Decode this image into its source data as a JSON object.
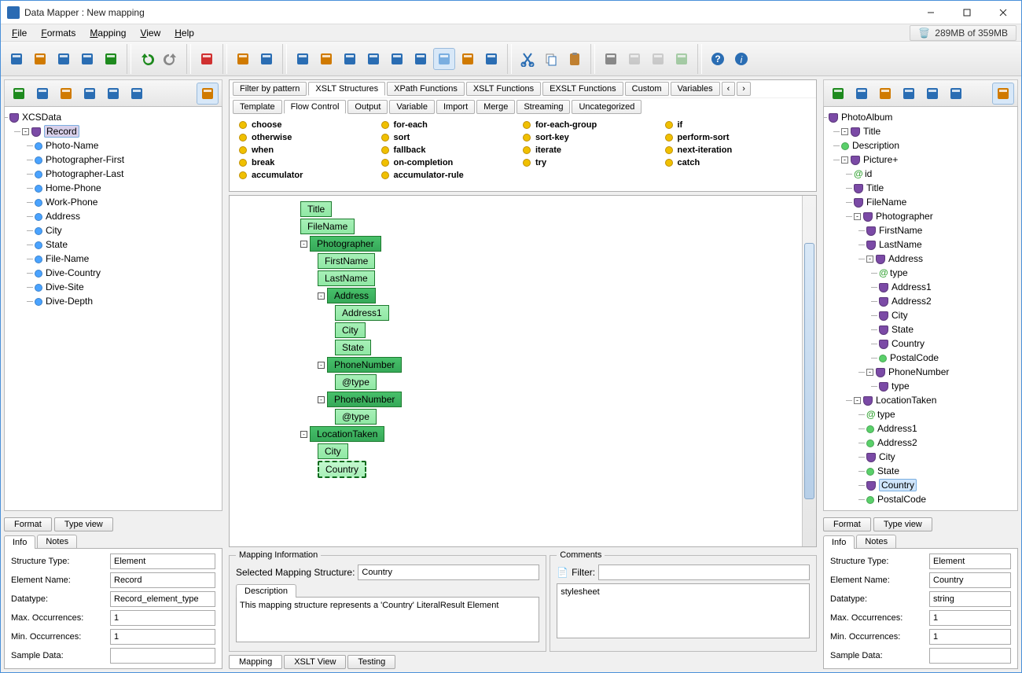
{
  "window": {
    "title": "Data Mapper : New mapping"
  },
  "menu": [
    "File",
    "Formats",
    "Mapping",
    "View",
    "Help"
  ],
  "memory": "289MB of 359MB",
  "left_tree": {
    "root": "XCSData",
    "record": "Record",
    "children": [
      "Photo-Name",
      "Photographer-First",
      "Photographer-Last",
      "Home-Phone",
      "Work-Phone",
      "Address",
      "City",
      "State",
      "File-Name",
      "Dive-Country",
      "Dive-Site",
      "Dive-Depth"
    ]
  },
  "right_tree": {
    "root": "PhotoAlbum",
    "title": "Title",
    "desc": "Description",
    "picture": "Picture+",
    "id": "id",
    "ptitle": "Title",
    "filename": "FileName",
    "photographer": "Photographer",
    "firstname": "FirstName",
    "lastname": "LastName",
    "address": "Address",
    "atype": "type",
    "addr1": "Address1",
    "addr2": "Address2",
    "city": "City",
    "state": "State",
    "country": "Country",
    "postal": "PostalCode",
    "phone": "PhoneNumber",
    "phonetype": "type",
    "loc": "LocationTaken",
    "ltype": "type",
    "laddr1": "Address1",
    "laddr2": "Address2",
    "lcity": "City",
    "lstate": "State",
    "lcountry": "Country",
    "lpostal": "PostalCode"
  },
  "fn_tabs": [
    "Filter by pattern",
    "XSLT Structures",
    "XPath Functions",
    "XSLT Functions",
    "EXSLT Functions",
    "Custom",
    "Variables"
  ],
  "fn_active": 1,
  "fn_cats": [
    "Template",
    "Flow Control",
    "Output",
    "Variable",
    "Import",
    "Merge",
    "Streaming",
    "Uncategorized"
  ],
  "fn_cat_active": 1,
  "fn_items": [
    [
      "choose",
      "for-each",
      "for-each-group",
      "if"
    ],
    [
      "otherwise",
      "sort",
      "sort-key",
      "perform-sort"
    ],
    [
      "when",
      "fallback",
      "iterate",
      "next-iteration"
    ],
    [
      "break",
      "on-completion",
      "try",
      "catch"
    ],
    [
      "accumulator",
      "accumulator-rule",
      "",
      ""
    ]
  ],
  "mapping_nodes": [
    {
      "t": "Title",
      "c": "lt",
      "i": 0
    },
    {
      "t": "FileName",
      "c": "lt",
      "i": 0
    },
    {
      "t": "Photographer",
      "c": "dk",
      "i": 0,
      "h": "-"
    },
    {
      "t": "FirstName",
      "c": "lt",
      "i": 1
    },
    {
      "t": "LastName",
      "c": "lt",
      "i": 1
    },
    {
      "t": "Address",
      "c": "dk",
      "i": 1,
      "h": "-"
    },
    {
      "t": "Address1",
      "c": "lt",
      "i": 2
    },
    {
      "t": "City",
      "c": "lt",
      "i": 2
    },
    {
      "t": "State",
      "c": "lt",
      "i": 2
    },
    {
      "t": "PhoneNumber",
      "c": "dk",
      "i": 1,
      "h": "-"
    },
    {
      "t": "@type",
      "c": "lt",
      "i": 2
    },
    {
      "t": "PhoneNumber",
      "c": "dk",
      "i": 1,
      "h": "-"
    },
    {
      "t": "@type",
      "c": "lt",
      "i": 2
    },
    {
      "t": "LocationTaken",
      "c": "dk",
      "i": 0,
      "h": "-"
    },
    {
      "t": "City",
      "c": "lt",
      "i": 1
    },
    {
      "t": "Country",
      "c": "sel",
      "i": 1
    }
  ],
  "bottom_tabs_left": [
    "Format",
    "Type view"
  ],
  "bottom_tabs_right": [
    "Format",
    "Type view"
  ],
  "info_tabs": [
    "Info",
    "Notes"
  ],
  "left_props": {
    "structure_type": "Element",
    "element_name": "Record",
    "datatype": "Record_element_type",
    "max": "1",
    "min": "1",
    "sample": ""
  },
  "right_props": {
    "structure_type": "Element",
    "element_name": "Country",
    "datatype": "string",
    "max": "1",
    "min": "1",
    "sample": ""
  },
  "labels": {
    "structure_type": "Structure Type:",
    "element_name": "Element Name:",
    "datatype": "Datatype:",
    "max": "Max. Occurrences:",
    "min": "Min. Occurrences:",
    "sample": "Sample Data:"
  },
  "mapinfo": {
    "legend": "Mapping Information",
    "sel_label": "Selected Mapping Structure:",
    "sel_value": "Country",
    "desc_tab": "Description",
    "desc_text": "This mapping structure represents a 'Country' LiteralResult Element"
  },
  "comments": {
    "legend": "Comments",
    "filter_label": "Filter:",
    "filter_value": "",
    "body": "stylesheet"
  },
  "center_tabs": [
    "Mapping",
    "XSLT View",
    "Testing"
  ]
}
